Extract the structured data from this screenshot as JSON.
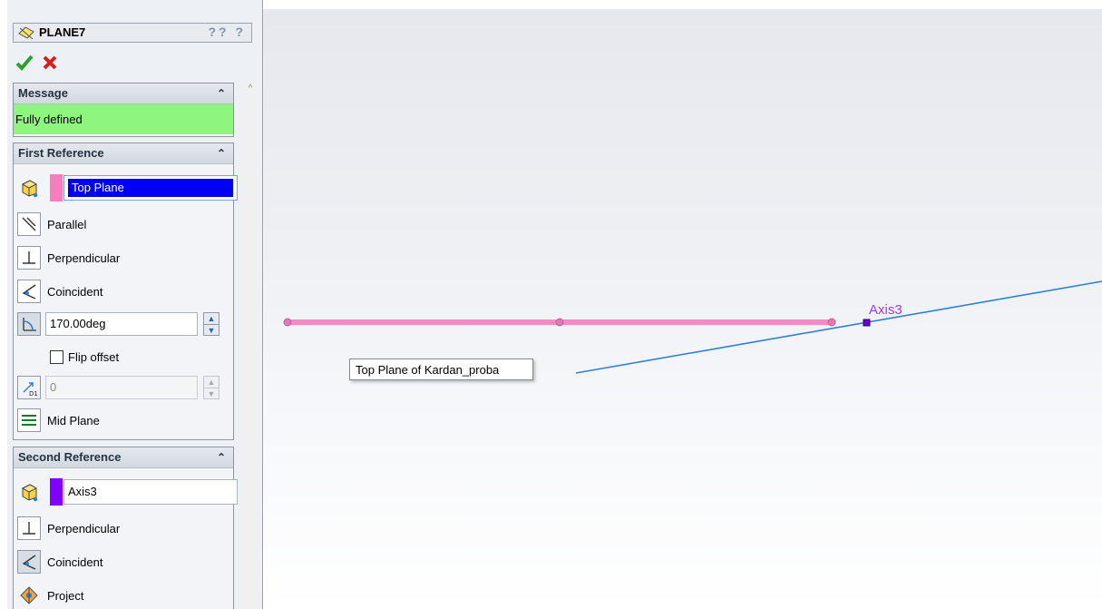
{
  "feature": {
    "title": "PLANE7",
    "help_icons": "?? ?"
  },
  "message": {
    "header": "Message",
    "text": "Fully defined",
    "color": "#8ef57f"
  },
  "first_reference": {
    "header": "First Reference",
    "selection": "Top Plane",
    "selection_color": "#f57fbd",
    "options": {
      "parallel": "Parallel",
      "perpendicular": "Perpendicular",
      "coincident": "Coincident"
    },
    "angle": "170.00deg",
    "flip_offset": "Flip offset",
    "instances": "0",
    "mid_plane": "Mid Plane"
  },
  "second_reference": {
    "header": "Second Reference",
    "selection": "Axis3",
    "selection_color": "#8000ff",
    "options": {
      "perpendicular": "Perpendicular",
      "coincident": "Coincident",
      "project": "Project"
    }
  },
  "viewport": {
    "tooltip": "Top Plane of Kardan_proba",
    "axis_label": "Axis3",
    "plane_color": "#f08cc4",
    "axis_color": "#2f7fd8"
  }
}
